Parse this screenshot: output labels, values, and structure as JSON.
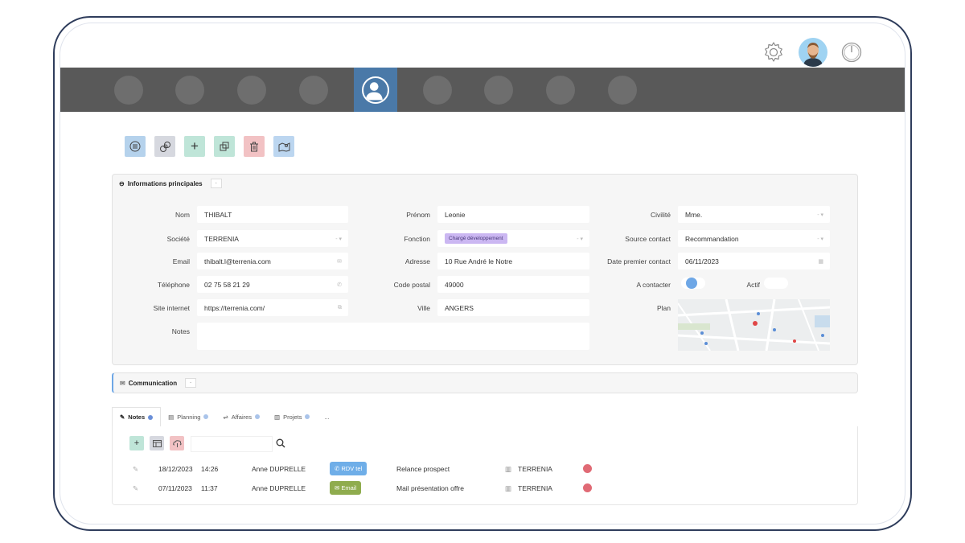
{
  "header": {
    "icons": [
      "gear-icon",
      "user-avatar",
      "power-icon"
    ]
  },
  "nav": {
    "items": [
      "nav-item-1",
      "nav-item-2",
      "nav-item-3",
      "nav-item-4",
      "contacts",
      "nav-item-6",
      "nav-item-7",
      "nav-item-8",
      "nav-item-9"
    ],
    "active": "contacts"
  },
  "toolbar": {
    "buttons": [
      {
        "name": "list-icon",
        "bg": "#b5d2ec"
      },
      {
        "name": "link-icon",
        "bg": "#d6d8df"
      },
      {
        "name": "add-icon",
        "bg": "#bfe5d8"
      },
      {
        "name": "duplicate-icon",
        "bg": "#bfe5d8"
      },
      {
        "name": "delete-icon",
        "bg": "#f2c2c4"
      },
      {
        "name": "map-icon",
        "bg": "#bcd6f0"
      }
    ]
  },
  "main_info": {
    "title": "Informations principales",
    "collapse_label": "-",
    "nom_label": "Nom",
    "nom": "THIBALT",
    "societe_label": "Société",
    "societe": "TERRENIA",
    "email_label": "Email",
    "email": "thibalt.l@terrenia.com",
    "telephone_label": "Téléphone",
    "telephone": "02 75 58 21 29",
    "site_label": "Site internet",
    "site": "https://terrenia.com/",
    "notes_label": "Notes",
    "notes": "",
    "prenom_label": "Prénom",
    "prenom": "Leonie",
    "fonction_label": "Fonction",
    "fonction": "Chargé développement",
    "adresse_label": "Adresse",
    "adresse": "10 Rue André le Notre",
    "cp_label": "Code postal",
    "cp": "49000",
    "ville_label": "Ville",
    "ville": "ANGERS",
    "civilite_label": "Civilité",
    "civilite": "Mme.",
    "source_label": "Source contact",
    "source": "Recommandation",
    "date_label": "Date premier contact",
    "date": "06/11/2023",
    "contacter_label": "A contacter",
    "actif_label": "Actif",
    "plan_label": "Plan",
    "select_arrows": "- ▾"
  },
  "communication": {
    "title": "Communication",
    "collapse_label": "-"
  },
  "tabs": [
    {
      "label": "Notes",
      "active": true
    },
    {
      "label": "Planning",
      "active": false
    },
    {
      "label": "Affaires",
      "active": false
    },
    {
      "label": "Projets",
      "active": false
    },
    {
      "label": "...",
      "active": false
    }
  ],
  "notes": {
    "search_placeholder": "",
    "rows": [
      {
        "date": "18/12/2023",
        "time": "14:26",
        "author": "Anne DUPRELLE",
        "type": "RDV tel",
        "type_color": "#6faee8",
        "subject": "Relance prospect",
        "company": "TERRENIA"
      },
      {
        "date": "07/11/2023",
        "time": "11:37",
        "author": "Anne DUPRELLE",
        "type": "Email",
        "type_color": "#8fac4e",
        "subject": "Mail présentation offre",
        "company": "TERRENIA"
      }
    ]
  },
  "colors": {
    "navbar": "#595959",
    "nav_active": "#4a79a8",
    "frame_border": "#2f3d5c",
    "toggle_on": "#6ea7e6"
  }
}
